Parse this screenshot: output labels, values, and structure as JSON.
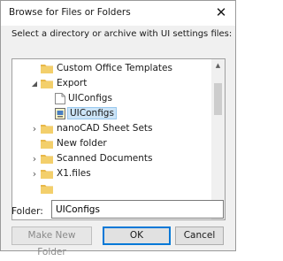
{
  "dialog": {
    "title": "Browse for Files or Folders",
    "close_glyph": "✕",
    "prompt": "Select a directory or archive with UI settings files:"
  },
  "tree": {
    "items": [
      {
        "label": "Custom Office Templates",
        "icon": "folder-icon",
        "expander": "",
        "level": 1
      },
      {
        "label": "Export",
        "icon": "folder-icon",
        "expander": "◢",
        "level": 1
      },
      {
        "label": "UIConfigs",
        "icon": "file-icon",
        "expander": "",
        "level": 2
      },
      {
        "label": "UIConfigs",
        "icon": "settings-file-icon",
        "expander": "",
        "level": 2,
        "selected": true
      },
      {
        "label": "nanoCAD Sheet Sets",
        "icon": "folder-icon",
        "expander": "›",
        "level": 1
      },
      {
        "label": "New folder",
        "icon": "folder-icon",
        "expander": "",
        "level": 1
      },
      {
        "label": "Scanned Documents",
        "icon": "folder-icon",
        "expander": "›",
        "level": 1
      },
      {
        "label": "X1.files",
        "icon": "folder-icon",
        "expander": "›",
        "level": 1
      },
      {
        "label": "",
        "icon": "folder-icon",
        "expander": "",
        "level": 1
      }
    ],
    "scroll_up_glyph": "▲",
    "scroll_down_glyph": "▼"
  },
  "folder": {
    "label": "Folder:",
    "value": "UIConfigs"
  },
  "buttons": {
    "make_new_folder": "Make New Folder",
    "ok": "OK",
    "cancel": "Cancel"
  },
  "colors": {
    "selection_bg": "#cce4f7",
    "selection_border": "#99c9ef",
    "folder_yellow": "#e8b84a",
    "default_button_border": "#0078d7"
  }
}
